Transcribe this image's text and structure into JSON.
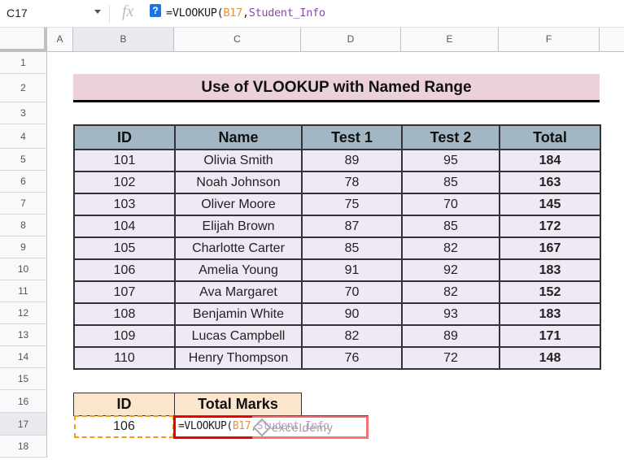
{
  "formula_bar": {
    "name_box": "C17",
    "fx_label": "fx",
    "help_icon": "?",
    "formula_prefix": "=VLOOKUP(",
    "formula_ref": "B17",
    "formula_sep": ",",
    "formula_name": "Student_Info"
  },
  "columns": [
    "A",
    "B",
    "C",
    "D",
    "E",
    "F"
  ],
  "rows": [
    "1",
    "2",
    "3",
    "4",
    "5",
    "6",
    "7",
    "8",
    "9",
    "10",
    "11",
    "12",
    "13",
    "14",
    "15",
    "16",
    "17",
    "18"
  ],
  "title": "Use of VLOOKUP with Named Range",
  "table": {
    "headers": [
      "ID",
      "Name",
      "Test 1",
      "Test 2",
      "Total"
    ],
    "rows": [
      [
        "101",
        "Olivia Smith",
        "89",
        "95",
        "184"
      ],
      [
        "102",
        "Noah Johnson",
        "78",
        "85",
        "163"
      ],
      [
        "103",
        "Oliver Moore",
        "75",
        "70",
        "145"
      ],
      [
        "104",
        "Elijah Brown",
        "87",
        "85",
        "172"
      ],
      [
        "105",
        "Charlotte Carter",
        "85",
        "82",
        "167"
      ],
      [
        "106",
        "Amelia Young",
        "91",
        "92",
        "183"
      ],
      [
        "107",
        "Ava Margaret",
        "70",
        "82",
        "152"
      ],
      [
        "108",
        "Benjamin White",
        "90",
        "93",
        "183"
      ],
      [
        "109",
        "Lucas Campbell",
        "82",
        "89",
        "171"
      ],
      [
        "110",
        "Henry Thompson",
        "76",
        "72",
        "148"
      ]
    ]
  },
  "lookup": {
    "headers": [
      "ID",
      "Total Marks"
    ],
    "id_value": "106",
    "formula_prefix": "=VLOOKUP(",
    "formula_ref": "B17",
    "formula_sep": ",",
    "formula_name": "Student_Info"
  },
  "watermark": "exceldemy",
  "colors": {
    "title_bg": "#ead1dc",
    "header_bg": "#a2b7c3",
    "row_bg": "#efe8f5",
    "lookup_header_bg": "#fce5cd",
    "ref_color": "#e69138",
    "name_color": "#8e44ad",
    "active_border": "#e00000"
  }
}
